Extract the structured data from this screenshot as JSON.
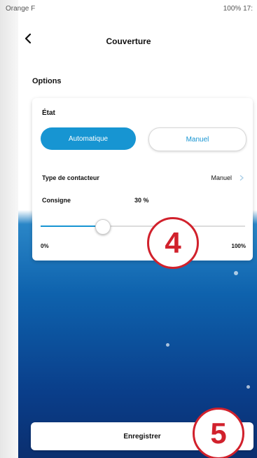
{
  "status_bar": {
    "left_text": "Orange F",
    "right_text": "100% 17:"
  },
  "header": {
    "title": "Couverture"
  },
  "options": {
    "section_label": "Options",
    "state_label": "État",
    "segments": [
      "Automatique",
      "Manuel"
    ],
    "selected_segment": "Automatique",
    "contactor_label": "Type de contacteur",
    "contactor_value": "Manuel",
    "setpoint_label": "Consigne",
    "setpoint_value": "30 %",
    "slider_level_percent": 30,
    "slider_min_label": "0%",
    "slider_max_label": "100%"
  },
  "annotations": {
    "badge_4": "4",
    "badge_5": "5",
    "badge_color": "#d1212c"
  },
  "footer": {
    "save_label": "Enregistrer"
  },
  "colors": {
    "accent": "#1795d2",
    "background_deep": "#0b2f6f"
  },
  "icons": {
    "back": "chevron-left-icon",
    "contactor_arrow": "chevron-right-icon"
  }
}
